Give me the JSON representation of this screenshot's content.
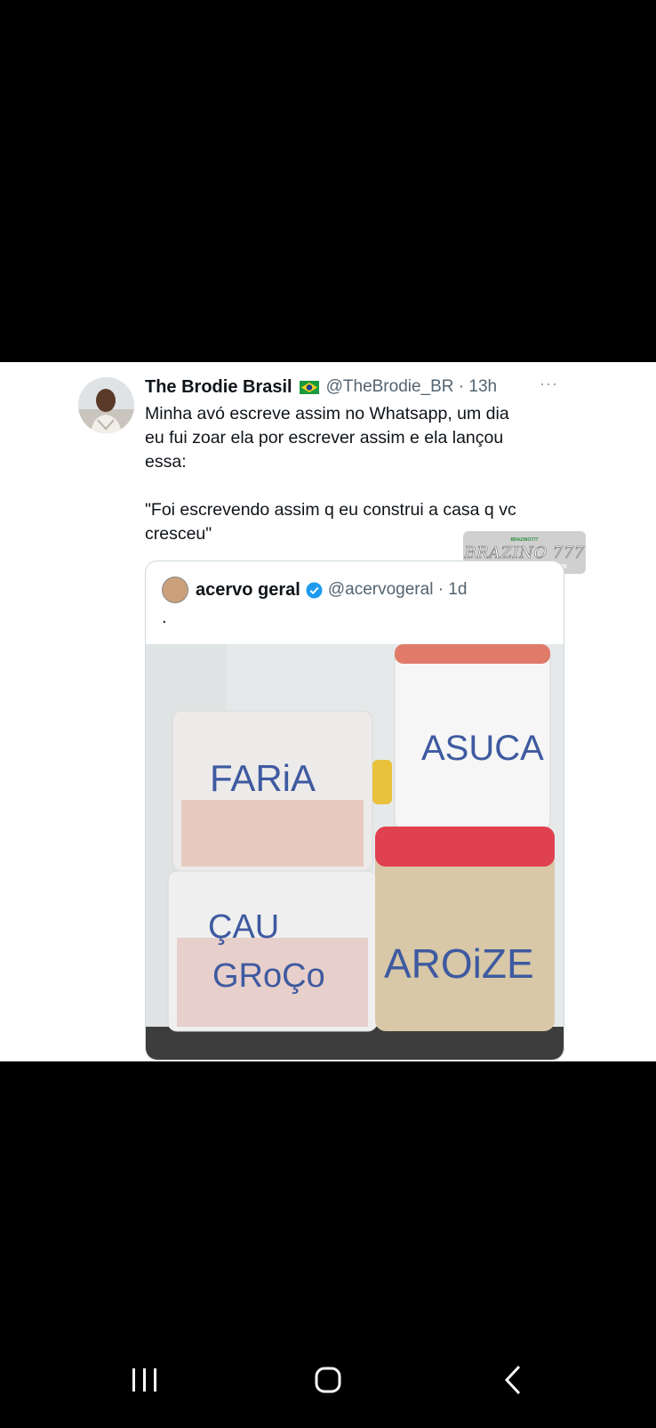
{
  "tweet": {
    "author": "The Brodie Brasil",
    "handle_time": "@TheBrodie_BR · 13h",
    "more": "···",
    "text": "Minha avó escreve assim no Whatsapp, um dia\neu fui zoar ela por escrever assim e ela lançou\nessa:\n\n\"Foi escrevendo assim q eu construi a casa q vc\ncresceu\""
  },
  "watermark": {
    "small_text": "BRAZINO777",
    "brand": "BRAZINO 777"
  },
  "quote": {
    "author": "acervo geral",
    "handle_time": "@acervogeral · 1d",
    "text": ".",
    "photo_labels": [
      "FARiA",
      "ASUCA",
      "ÇAU",
      "GRoÇo",
      "AROiZE"
    ]
  },
  "icons": [
    "brazil-flag-icon",
    "more-icon",
    "verified-badge-icon",
    "recent-apps-icon",
    "home-icon",
    "back-icon"
  ]
}
